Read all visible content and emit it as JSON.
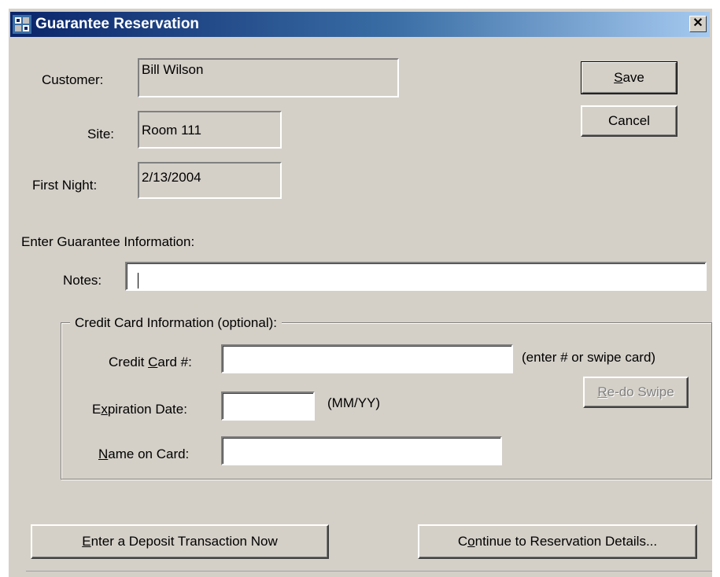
{
  "window": {
    "title": "Guarantee Reservation",
    "close_glyph": "✕"
  },
  "info": {
    "customer_label": "Customer:",
    "customer_value": "Bill Wilson",
    "site_label": "Site:",
    "site_value": "Room 111",
    "first_night_label": "First Night:",
    "first_night_value": "2/13/2004"
  },
  "actions": {
    "save": "ave",
    "save_mnemonic": "S",
    "cancel": "Cancel"
  },
  "guarantee": {
    "section_label": "Enter Guarantee Information:",
    "notes_label": "Notes:",
    "notes_value": ""
  },
  "credit_card": {
    "group_label": "Credit Card Information (optional):",
    "number_label_pre": "Credit ",
    "number_label_mnemonic": "C",
    "number_label_post": "ard #:",
    "number_value": "",
    "number_hint": "(enter # or swipe card)",
    "expiration_label_pre": "E",
    "expiration_label_mnemonic": "x",
    "expiration_label_post": "piration Date:",
    "expiration_value": "",
    "expiration_hint": "(MM/YY)",
    "name_label_mnemonic": "N",
    "name_label_post": "ame on Card:",
    "name_value": "",
    "redo_swipe_mnemonic": "R",
    "redo_swipe_post": "e-do Swipe"
  },
  "footer": {
    "deposit_mnemonic": "E",
    "deposit_post": "nter a Deposit Transaction Now",
    "continue_pre": "C",
    "continue_mnemonic": "o",
    "continue_post": "ntinue to Reservation Details..."
  },
  "icons": {
    "app": "hotel-app-icon",
    "close": "close-icon"
  }
}
